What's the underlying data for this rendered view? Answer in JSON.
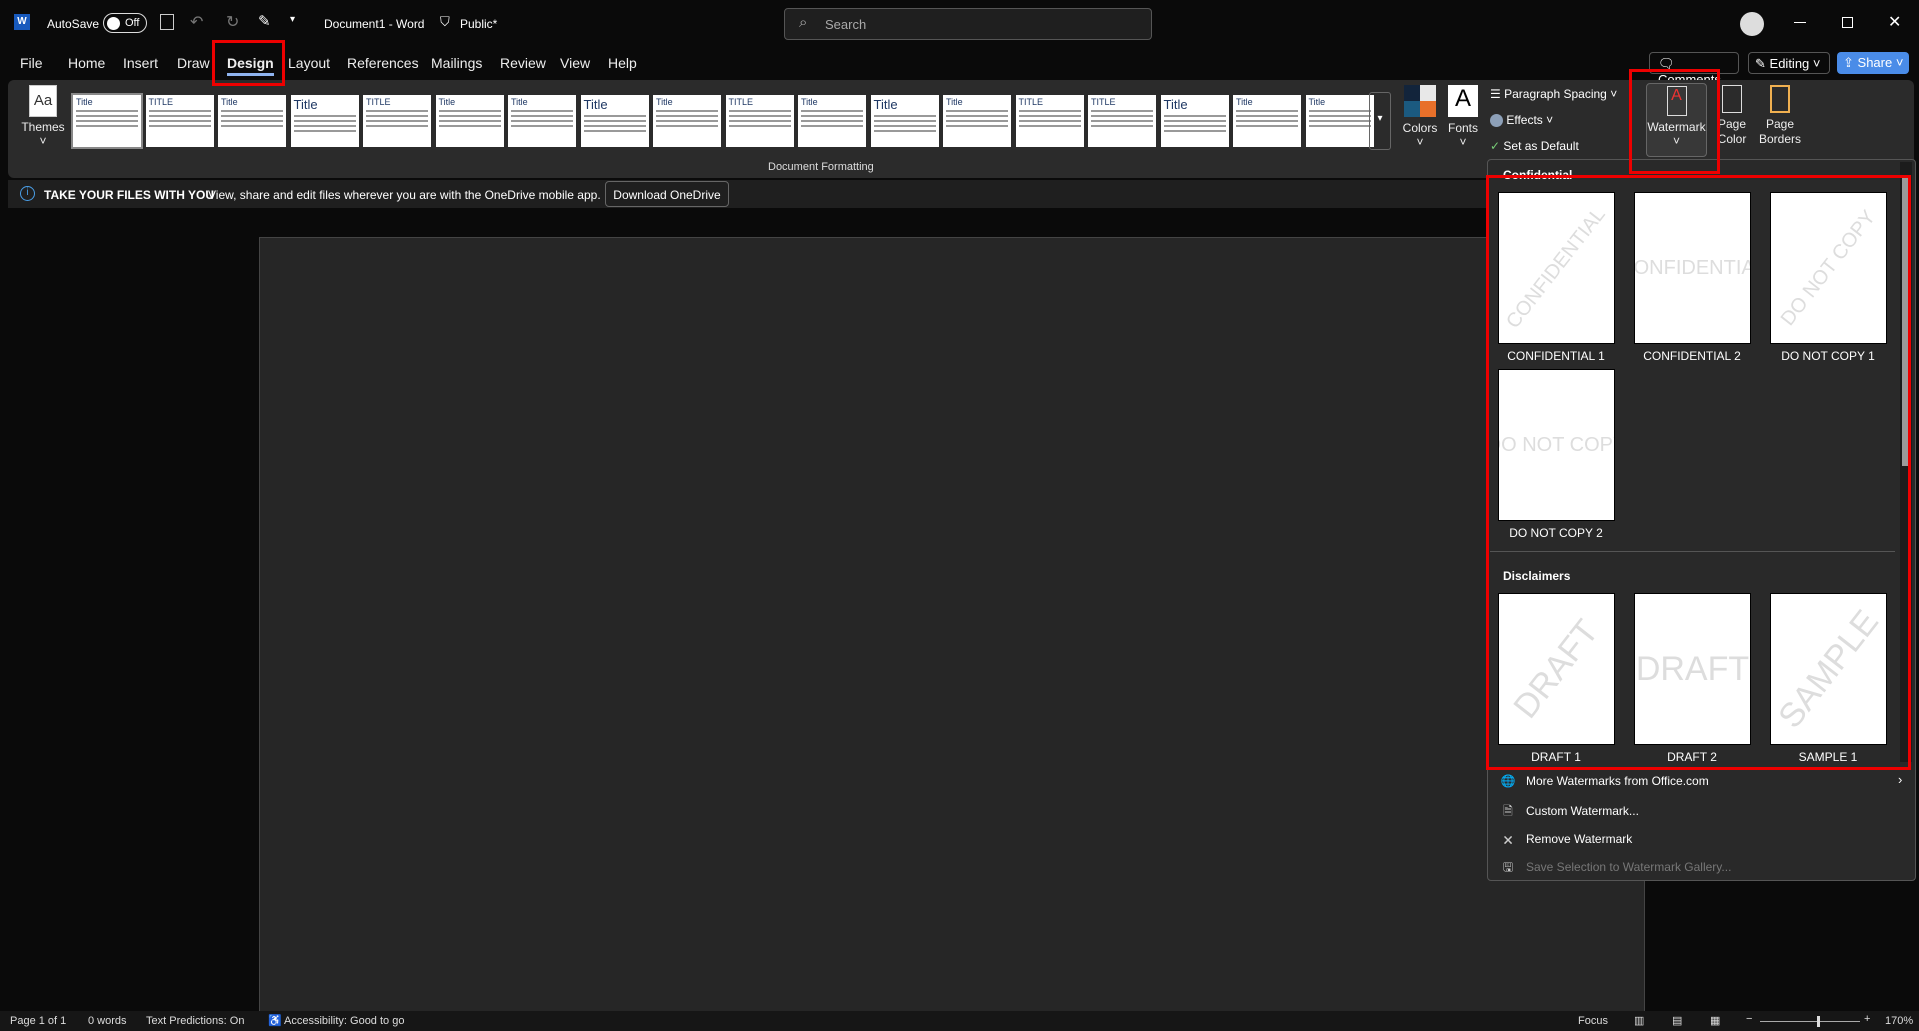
{
  "titlebar": {
    "autosave_label": "AutoSave",
    "autosave_state": "Off",
    "doc_title": "Document1  -  Word",
    "sensitivity": "Public*",
    "search_placeholder": "Search"
  },
  "tabs": [
    "File",
    "Home",
    "Insert",
    "Draw",
    "Design",
    "Layout",
    "References",
    "Mailings",
    "Review",
    "View",
    "Help"
  ],
  "active_tab": "Design",
  "header_buttons": {
    "comments": "Comments",
    "editing": "Editing",
    "share": "Share"
  },
  "ribbon": {
    "themes": "Themes",
    "style_thumbs": [
      "Title",
      "TITLE",
      "Title",
      "Title",
      "TITLE",
      "Title",
      "Title",
      "Title",
      "Title",
      "TITLE",
      "Title",
      "Title",
      "Title",
      "TITLE",
      "TITLE",
      "Title",
      "Title",
      "Title"
    ],
    "group_label": "Document Formatting",
    "colors": "Colors",
    "fonts": "Fonts",
    "paragraph_spacing": "Paragraph Spacing",
    "effects": "Effects",
    "set_default": "Set as Default",
    "watermark": "Watermark",
    "page_color": "Page Color",
    "page_borders": "Page Borders"
  },
  "infobar": {
    "title": "TAKE YOUR FILES WITH YOU",
    "message": "View, share and edit files wherever you are with the OneDrive mobile app.",
    "button": "Download OneDrive"
  },
  "watermark_panel": {
    "sections": [
      {
        "header": "Confidential",
        "items": [
          {
            "label": "CONFIDENTIAL 1",
            "text": "CONFIDENTIAL",
            "diagonal": true
          },
          {
            "label": "CONFIDENTIAL 2",
            "text": "CONFIDENTIAL",
            "diagonal": false
          },
          {
            "label": "DO NOT COPY 1",
            "text": "DO NOT COPY",
            "diagonal": true
          },
          {
            "label": "DO NOT COPY 2",
            "text": "DO NOT COPY",
            "diagonal": false
          }
        ]
      },
      {
        "header": "Disclaimers",
        "items": [
          {
            "label": "DRAFT 1",
            "text": "DRAFT",
            "diagonal": true
          },
          {
            "label": "DRAFT 2",
            "text": "DRAFT",
            "diagonal": false
          },
          {
            "label": "SAMPLE 1",
            "text": "SAMPLE",
            "diagonal": true
          }
        ]
      }
    ],
    "menu": [
      "More Watermarks from Office.com",
      "Custom Watermark...",
      "Remove Watermark",
      "Save Selection to Watermark Gallery..."
    ]
  },
  "status": {
    "page": "Page 1 of 1",
    "words": "0 words",
    "predictions": "Text Predictions: On",
    "accessibility": "Accessibility: Good to go",
    "focus": "Focus",
    "zoom": "170%"
  },
  "colors": {
    "accent": "#4a8ce8",
    "annotation": "#e00000"
  }
}
